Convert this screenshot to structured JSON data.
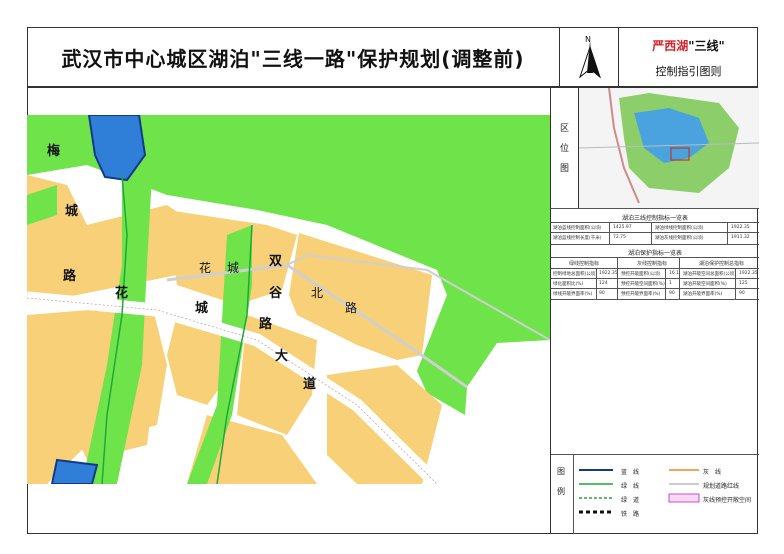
{
  "header": {
    "title": "武汉市中心城区湖泊\"三线一路\"保护规划(调整前)",
    "north_letter": "N",
    "brand_lake": "严西湖",
    "brand_suffix": "\"三线\"",
    "brand_subtitle": "控制指引图则"
  },
  "map": {
    "road_labels": {
      "mei": "梅",
      "cheng1": "城",
      "lu1": "路",
      "hua1": "花",
      "cheng2": "城",
      "hua2": "花",
      "cheng3": "城",
      "shuang": "双",
      "gu": "谷",
      "lu2": "路",
      "da": "大",
      "dao": "道",
      "bei": "北",
      "lu3": "路"
    }
  },
  "panel": {
    "location": {
      "c1": "区",
      "c2": "位",
      "c3": "图"
    },
    "table1": {
      "title": "湖泊三线控制指标一览表",
      "rows": [
        [
          "湖泊蓝线控制面积(公顷)",
          "1425.97",
          "湖泊绿线控制面积(公顷)",
          "1922.35"
        ],
        [
          "湖泊蓝线控制长度(千米)",
          "72.75",
          "湖泊灰线控制面积(公顷)",
          "1911.32"
        ]
      ]
    },
    "table2": {
      "title": "湖泊保护指标一览表",
      "headers": [
        "绿线控制指标",
        "灰线控制指标",
        "湖泊保护控制总指标"
      ],
      "rows": [
        [
          "控制绿地总面积(公顷)",
          "1922.35",
          "预控开敞面积(公顷)",
          "16.1",
          "湖泊开敞空间总面积(公顷)",
          "1922.35"
        ],
        [
          "绿化面积比(%)",
          "124",
          "预控开敞空间面积(%)",
          "1",
          "湖泊开敞空间面积(%)",
          "125"
        ],
        [
          "绿线开敞界面率(%)",
          "90",
          "预控开敞界面率(%)",
          "90",
          "湖泊开敞界面率(%)",
          "90"
        ]
      ]
    },
    "legend": {
      "label_tu": "图",
      "label_li": "例",
      "items": {
        "blue": "蓝　线",
        "green": "绿　线",
        "green_dash": "绿　道",
        "railway": "铁　路",
        "grey": "灰　线",
        "planned_road": "规划道路红线",
        "pink": "灰线预控开敞空间"
      }
    }
  },
  "colors": {
    "green": "#6fe34a",
    "yellow": "#f7d077",
    "blue": "#2f7ed8",
    "road": "#ffffff",
    "brand_red": "#d6232a"
  }
}
